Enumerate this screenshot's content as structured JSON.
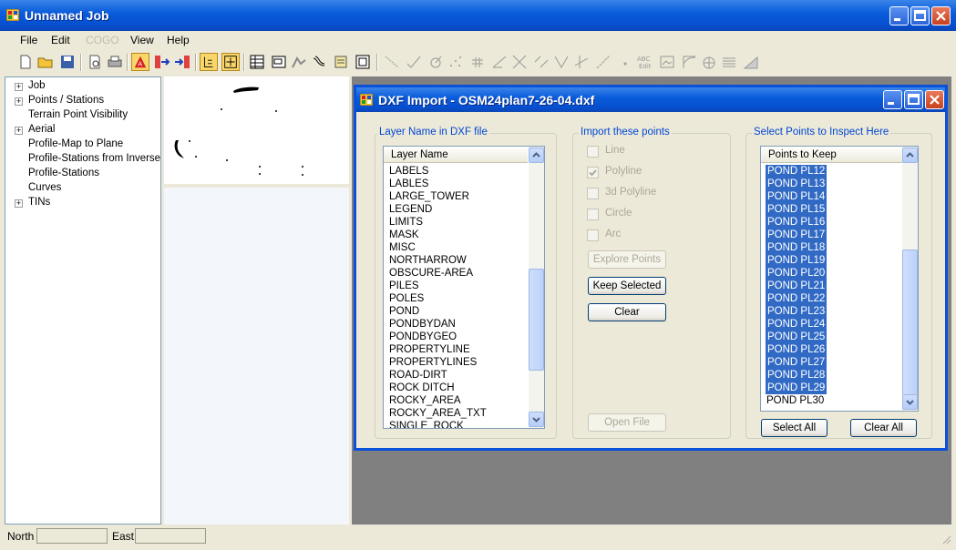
{
  "app": {
    "title": "Unnamed Job",
    "menu": [
      "File",
      "Edit",
      "COGO",
      "View",
      "Help"
    ]
  },
  "tree": {
    "items": [
      "Job",
      "Points / Stations",
      "Terrain Point Visibility",
      "Aerial",
      "Profile-Map to Plane",
      "Profile-Stations from Inverse",
      "Profile-Stations",
      "Curves",
      "TINs"
    ]
  },
  "statusbar": {
    "north_label": "North",
    "east_label": "East",
    "north_value": "",
    "east_value": ""
  },
  "dialog": {
    "title": "DXF Import - OSM24plan7-26-04.dxf",
    "layer_group": {
      "title": "Layer Name in DXF file",
      "header": "Layer Name",
      "rows": [
        "LABELS",
        "LABLES",
        "LARGE_TOWER",
        "LEGEND",
        "LIMITS",
        "MASK",
        "MISC",
        "NORTHARROW",
        "OBSCURE-AREA",
        "PILES",
        "POLES",
        "POND",
        "PONDBYDAN",
        "PONDBYGEO",
        "PROPERTYLINE",
        "PROPERTYLINES",
        "ROAD-DIRT",
        "ROCK DITCH",
        "ROCKY_AREA",
        "ROCKY_AREA_TXT",
        "SINGLE_ROCK"
      ]
    },
    "import_group": {
      "title": "Import these points",
      "options": [
        {
          "label": "Line",
          "checked": false
        },
        {
          "label": "Polyline",
          "checked": true
        },
        {
          "label": "3d Polyline",
          "checked": false
        },
        {
          "label": "Circle",
          "checked": false
        },
        {
          "label": "Arc",
          "checked": false
        }
      ],
      "explore": "Explore Points",
      "keep": "Keep Selected",
      "clear": "Clear",
      "open": "Open File"
    },
    "points_group": {
      "title": "Select Points to Inspect Here",
      "header": "Points to Keep",
      "rows": [
        "POND PL12",
        "POND PL13",
        "POND PL14",
        "POND PL15",
        "POND PL16",
        "POND PL17",
        "POND PL18",
        "POND PL19",
        "POND PL20",
        "POND PL21",
        "POND PL22",
        "POND PL23",
        "POND PL24",
        "POND PL25",
        "POND PL26",
        "POND PL27",
        "POND PL28",
        "POND PL29",
        "POND PL30"
      ],
      "selected_count": 18,
      "select_all": "Select  All",
      "clear_all": "Clear All"
    }
  },
  "icons": [
    "new-file-icon",
    "open-folder-icon",
    "save-icon",
    "print-preview-icon",
    "print-icon",
    "dxf-import-icon",
    "export-icon",
    "import-icon",
    "select-icon",
    "zoom-extents-icon",
    "table-icon",
    "window-icon",
    "surface-icon",
    "contour-icon",
    "report-icon",
    "properties-icon",
    "line-tool-icon",
    "check-tool-icon",
    "circle-tool-icon",
    "points-tool-icon",
    "grid-tool-icon",
    "angle-tool-icon",
    "cross-tool-icon",
    "offset-tool-icon",
    "vee-tool-icon",
    "intersect-tool-icon",
    "slope-tool-icon",
    "dot-tool-icon",
    "abc-edit-icon",
    "image-tool-icon",
    "curve-tool-icon",
    "arc-tool-icon",
    "hatch-tool-icon",
    "triangle-tool-icon"
  ],
  "colors": {
    "accent": "#0a5ddc",
    "selection": "#316ac5",
    "group_title": "#0046d5"
  }
}
